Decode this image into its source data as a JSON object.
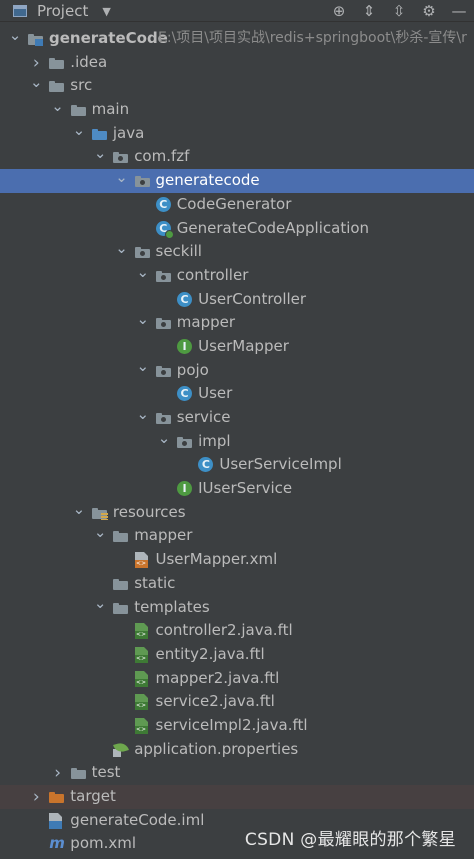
{
  "toolbar": {
    "title": "Project",
    "caret_icon": "dropdown-caret",
    "buttons": [
      {
        "name": "locate-icon",
        "glyph": "⊕"
      },
      {
        "name": "expand-all-icon",
        "glyph": "⇕"
      },
      {
        "name": "collapse-all-icon",
        "glyph": "⇳"
      },
      {
        "name": "gear-icon",
        "glyph": "⚙"
      },
      {
        "name": "hide-icon",
        "glyph": "—"
      }
    ]
  },
  "tree": [
    {
      "label": "generateCode",
      "path": "E:\\项目\\项目实战\\redis+springboot\\秒杀-宣传\\r",
      "icon": "module-folder",
      "depth": 0,
      "expanded": true,
      "bold": true
    },
    {
      "label": ".idea",
      "icon": "folder",
      "depth": 1,
      "expanded": false
    },
    {
      "label": "src",
      "icon": "folder",
      "depth": 1,
      "expanded": true
    },
    {
      "label": "main",
      "icon": "folder",
      "depth": 2,
      "expanded": true
    },
    {
      "label": "java",
      "icon": "folder-blue",
      "depth": 3,
      "expanded": true
    },
    {
      "label": "com.fzf",
      "icon": "package",
      "depth": 4,
      "expanded": true
    },
    {
      "label": "generatecode",
      "icon": "package",
      "depth": 5,
      "expanded": true,
      "selected": true
    },
    {
      "label": "CodeGenerator",
      "icon": "class",
      "depth": 6
    },
    {
      "label": "GenerateCodeApplication",
      "icon": "class-run",
      "depth": 6
    },
    {
      "label": "seckill",
      "icon": "package",
      "depth": 5,
      "expanded": true
    },
    {
      "label": "controller",
      "icon": "package",
      "depth": 6,
      "expanded": true
    },
    {
      "label": "UserController",
      "icon": "class",
      "depth": 7
    },
    {
      "label": "mapper",
      "icon": "package",
      "depth": 6,
      "expanded": true
    },
    {
      "label": "UserMapper",
      "icon": "interface",
      "depth": 7
    },
    {
      "label": "pojo",
      "icon": "package",
      "depth": 6,
      "expanded": true
    },
    {
      "label": "User",
      "icon": "class",
      "depth": 7
    },
    {
      "label": "service",
      "icon": "package",
      "depth": 6,
      "expanded": true
    },
    {
      "label": "impl",
      "icon": "package",
      "depth": 7,
      "expanded": true
    },
    {
      "label": "UserServiceImpl",
      "icon": "class",
      "depth": 8
    },
    {
      "label": "IUserService",
      "icon": "interface",
      "depth": 7
    },
    {
      "label": "resources",
      "icon": "resources-folder",
      "depth": 3,
      "expanded": true
    },
    {
      "label": "mapper",
      "icon": "folder",
      "depth": 4,
      "expanded": true
    },
    {
      "label": "UserMapper.xml",
      "icon": "xml-file",
      "depth": 5
    },
    {
      "label": "static",
      "icon": "folder",
      "depth": 4
    },
    {
      "label": "templates",
      "icon": "folder",
      "depth": 4,
      "expanded": true
    },
    {
      "label": "controller2.java.ftl",
      "icon": "ftl-file",
      "depth": 5
    },
    {
      "label": "entity2.java.ftl",
      "icon": "ftl-file",
      "depth": 5
    },
    {
      "label": "mapper2.java.ftl",
      "icon": "ftl-file",
      "depth": 5
    },
    {
      "label": "service2.java.ftl",
      "icon": "ftl-file",
      "depth": 5
    },
    {
      "label": "serviceImpl2.java.ftl",
      "icon": "ftl-file",
      "depth": 5
    },
    {
      "label": "application.properties",
      "icon": "spring-properties",
      "depth": 4
    },
    {
      "label": "test",
      "icon": "folder",
      "depth": 2,
      "expanded": false
    },
    {
      "label": "target",
      "icon": "folder-orange",
      "depth": 1,
      "expanded": false,
      "target": true
    },
    {
      "label": "generateCode.iml",
      "icon": "iml-file",
      "depth": 1
    },
    {
      "label": "pom.xml",
      "icon": "maven-file",
      "depth": 1
    }
  ],
  "watermark": "CSDN @最耀眼的那个繁星",
  "colors": {
    "background": "#3c3f41",
    "selection": "#4b6eaf",
    "text": "#bbbbbb",
    "excluded_bg": "#474041"
  }
}
